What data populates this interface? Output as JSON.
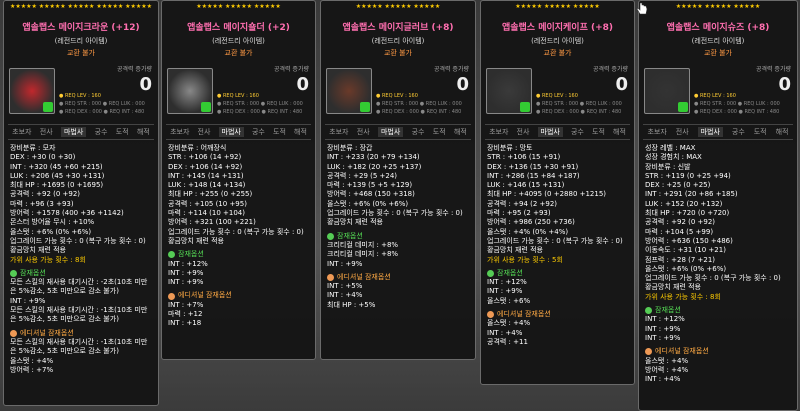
{
  "items": [
    {
      "stars": "★★★★★ ★★★★★ ★★★★★ ★★★★★ ★★★★★",
      "name": "앱솔랩스 메이지크라운 (+12)",
      "grade": "(레전드리 아이템)",
      "trade": "교환 불가",
      "atk_label": "공격력 증가량",
      "atk_value": "0",
      "req": [
        "● REQ LEV : 160",
        "● REQ STR : 000   ● REQ LUK : 000",
        "● REQ DEX : 000   ● REQ INT : 480"
      ],
      "jobs": [
        "초보자",
        "전사",
        "마법사",
        "궁수",
        "도적",
        "해적"
      ],
      "active_job": "마법사",
      "lines": [
        "장비분류 : 모자",
        "DEX : +30 (0 +30)",
        "INT : +320 (45 +60 +215)",
        "LUK : +206 (45 +30 +131)",
        "최대 HP : +1695 (0 +1695)",
        "공격력 : +92 (0 +92)",
        "마력 : +96 (3 +93)",
        "방어력 : +1578 (400 +36 +1142)",
        "몬스터 방어율 무시 : +10%",
        "올스탯 : +6% (0% +6%)",
        "업그레이드 가능 횟수 : 0 (복구 가능 횟수 : 0)",
        "황금망치 재련 적용",
        "가위 사용 가능 횟수 : 8회"
      ],
      "pot_title": "잠재옵션",
      "pot": [
        "모든 스킬의 재사용 대기시간 : -2초(10초 미만",
        "은 5%감소, 5초 미만으로 감소 불가)",
        "INT : +9%",
        "모든 스킬의 재사용 대기시간 : -1초(10초 미만",
        "은 5%감소, 5초 미만으로 감소 불가)"
      ],
      "bpot_title": "에디셔널 잠재옵션",
      "bpot": [
        "모든 스킬의 재사용 대기시간 : -1초(10초 미만",
        "은 5%감소, 5초 미만으로 감소 불가)",
        "올스탯 : +4%",
        "방어력 : +7%"
      ],
      "colors": {
        "icon": "#c0282d"
      }
    },
    {
      "stars": "★★★★★ ★★★★★ ★★★★★",
      "name": "앱솔랩스 메이지숄더 (+2)",
      "grade": "(레전드리 아이템)",
      "trade": "교환 불가",
      "atk_label": "공격력 증가량",
      "atk_value": "0",
      "req": [
        "● REQ LEV : 160",
        "● REQ STR : 000   ● REQ LUK : 000",
        "● REQ DEX : 000   ● REQ INT : 480"
      ],
      "jobs": [
        "초보자",
        "전사",
        "마법사",
        "궁수",
        "도적",
        "해적"
      ],
      "active_job": "마법사",
      "lines": [
        "장비분류 : 어깨장식",
        "STR : +106 (14 +92)",
        "DEX : +106 (14 +92)",
        "INT : +145 (14 +131)",
        "LUK : +148 (14 +134)",
        "최대 HP : +255 (0 +255)",
        "공격력 : +105 (10 +95)",
        "마력 : +114 (10 +104)",
        "방어력 : +321 (100 +221)",
        "업그레이드 가능 횟수 : 0 (복구 가능 횟수 : 0)",
        "황금망치 재련 적용"
      ],
      "pot_title": "잠재옵션",
      "pot": [
        "INT : +12%",
        "INT : +9%",
        "INT : +9%"
      ],
      "bpot_title": "에디셔널 잠재옵션",
      "bpot": [
        "INT : +7%",
        "마력 : +12",
        "INT : +18"
      ],
      "colors": {
        "icon": "#888"
      }
    },
    {
      "stars": "★★★★★ ★★★★★ ★★★★★",
      "name": "앱솔랩스 메이지글러브 (+8)",
      "grade": "(레전드리 아이템)",
      "trade": "교환 불가",
      "atk_label": "공격력 증가량",
      "atk_value": "0",
      "req": [
        "● REQ LEV : 160",
        "● REQ STR : 000   ● REQ LUK : 000",
        "● REQ DEX : 000   ● REQ INT : 480"
      ],
      "jobs": [
        "초보자",
        "전사",
        "마법사",
        "궁수",
        "도적",
        "해적"
      ],
      "active_job": "마법사",
      "lines": [
        "장비분류 : 장갑",
        "INT : +233 (20 +79 +134)",
        "LUK : +182 (20 +25 +137)",
        "공격력 : +29 (5 +24)",
        "마력 : +139 (5 +5 +129)",
        "방어력 : +468 (150 +318)",
        "올스탯 : +6% (0% +6%)",
        "업그레이드 가능 횟수 : 0 (복구 가능 횟수 : 0)",
        "황금망치 재련 적용"
      ],
      "pot_title": "잠재옵션",
      "pot": [
        "크리티컬 데미지 : +8%",
        "크리티컬 데미지 : +8%",
        "INT : +9%"
      ],
      "bpot_title": "에디셔널 잠재옵션",
      "bpot": [
        "INT : +5%",
        "INT : +4%",
        "최대 HP : +5%"
      ],
      "colors": {
        "icon": "#6a3a2a"
      }
    },
    {
      "stars": "★★★★★ ★★★★★ ★★★★★",
      "name": "앱솔랩스 메이지케이프 (+8)",
      "grade": "(레전드리 아이템)",
      "trade": "교환 불가",
      "atk_label": "공격력 증가량",
      "atk_value": "0",
      "req": [
        "● REQ LEV : 160",
        "● REQ STR : 000   ● REQ LUK : 000",
        "● REQ DEX : 000   ● REQ INT : 480"
      ],
      "jobs": [
        "초보자",
        "전사",
        "마법사",
        "궁수",
        "도적",
        "해적"
      ],
      "active_job": "마법사",
      "lines": [
        "장비분류 : 망토",
        "STR : +106 (15 +91)",
        "DEX : +136 (15 +30 +91)",
        "INT : +286 (15 +84 +187)",
        "LUK : +146 (15 +131)",
        "최대 HP : +4095 (0 +2880 +1215)",
        "공격력 : +94 (2 +92)",
        "마력 : +95 (2 +93)",
        "방어력 : +986 (250 +736)",
        "올스탯 : +4% (0% +4%)",
        "업그레이드 가능 횟수 : 0 (복구 가능 횟수 : 0)",
        "황금망치 재련 적용",
        "가위 사용 가능 횟수 : 5회"
      ],
      "pot_title": "잠재옵션",
      "pot": [
        "INT : +12%",
        "INT : +9%",
        "올스탯 : +6%"
      ],
      "bpot_title": "에디셔널 잠재옵션",
      "bpot": [
        "올스탯 : +4%",
        "INT : +4%",
        "공격력 : +11"
      ],
      "colors": {
        "icon": "#3a3a3a"
      }
    },
    {
      "stars": "★★★★★ ★★★★★ ★★★★★",
      "name": "앱솔랩스 메이지슈즈 (+8)",
      "grade": "(레전드리 아이템)",
      "trade": "교환 불가",
      "atk_label": "공격력 증가량",
      "atk_value": "0",
      "req": [
        "● REQ LEV : 160",
        "● REQ STR : 000   ● REQ LUK : 000",
        "● REQ DEX : 000   ● REQ INT : 480"
      ],
      "jobs": [
        "초보자",
        "전사",
        "마법사",
        "궁수",
        "도적",
        "해적"
      ],
      "active_job": "마법사",
      "lines": [
        "성장 레벨 : MAX",
        "성장 경험치 : MAX",
        "장비분류 : 신발",
        "STR : +119 (0 +25 +94)",
        "DEX : +25 (0 +25)",
        "INT : +291 (20 +86 +185)",
        "LUK : +152 (20 +132)",
        "최대 HP : +720 (0 +720)",
        "공격력 : +92 (0 +92)",
        "마력 : +104 (5 +99)",
        "방어력 : +636 (150 +486)",
        "이동속도 : +31 (10 +21)",
        "점프력 : +28 (7 +21)",
        "올스탯 : +6% (0% +6%)",
        "업그레이드 가능 횟수 : 0 (복구 가능 횟수 : 0)",
        "황금망치 재련 적용",
        "가위 사용 가능 횟수 : 8회"
      ],
      "pot_title": "잠재옵션",
      "pot": [
        "INT : +12%",
        "INT : +9%",
        "INT : +9%"
      ],
      "bpot_title": "에디셔널 잠재옵션",
      "bpot": [
        "올스탯 : +4%",
        "방어력 : +4%",
        "INT : +4%"
      ],
      "colors": {
        "icon": "#333"
      }
    }
  ]
}
